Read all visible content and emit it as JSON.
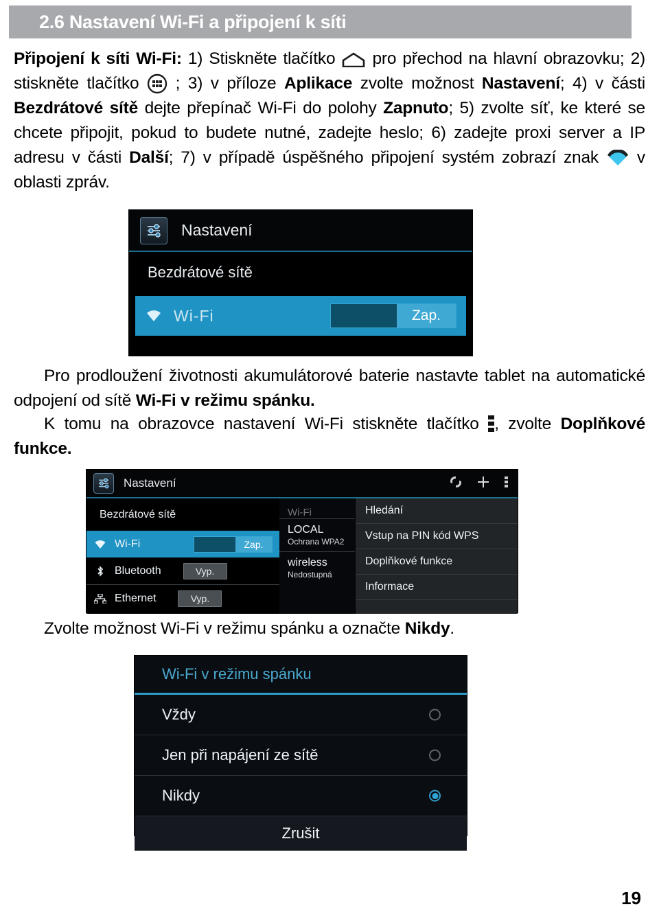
{
  "header": {
    "number": "2.6",
    "title": "2.6 Nastavení Wi-Fi a připojení k síti",
    "bg_color": "#a8a9ad",
    "text_color": "#ffffff"
  },
  "paragraphs": {
    "p1_lead": "Připojení k síti Wi-Fi:",
    "p1_a": " 1) Stiskněte tlačítko ",
    "p1_b": " pro přechod na hlavní obrazovku; 2) stiskněte tlačítko ",
    "p1_c": " ; 3) v příloze ",
    "p1_bold1": "Aplikace",
    "p1_d": " zvolte možnost ",
    "p1_bold2": "Nastavení",
    "p1_e": "; 4) v části ",
    "p1_bold3": "Bezdrátové sítě",
    "p1_f": " dejte přepínač Wi-Fi do polohy ",
    "p1_bold4": "Zapnuto",
    "p1_g": "; 5) zvolte síť, ke které se chcete připojit, pokud to budete nutné, zadejte heslo; 6) zadejte proxi server a IP adresu v části ",
    "p1_bold5": "Další",
    "p1_h": "; 7) v případě úspěšného připojení systém zobrazí znak ",
    "p1_i": " v oblasti zpráv.",
    "p2_a": "Pro prodloužení životnosti akumulátorové baterie nastavte tablet na automatické odpojení od sítě ",
    "p2_bold": "Wi-Fi v režimu spánku.",
    "p3_a": "K tomu na obrazovce nastavení Wi-Fi stiskněte tlačítko ",
    "p3_b": ", zvolte ",
    "p3_bold": "Doplňkové",
    "p3_c": " funkce.",
    "p4_a": "Zvolte možnost Wi-Fi  v režimu spánku a označte ",
    "p4_bold": "Nikdy",
    "p4_b": "."
  },
  "shot1": {
    "appbar_title": "Nastavení",
    "section_label": "Bezdrátové sítě",
    "wifi_label": "Wi-Fi",
    "wifi_toggle": "Zap.",
    "highlight_color": "#1f94c4"
  },
  "shot2": {
    "appbar_title": "Nastavení",
    "section_label": "Bezdrátové sítě",
    "rows": [
      {
        "label": "Wi-Fi",
        "toggle": "Zap.",
        "state": "on",
        "icon": "wifi-icon"
      },
      {
        "label": "Bluetooth",
        "toggle": "Vyp.",
        "state": "off",
        "icon": "bluetooth-icon"
      },
      {
        "label": "Ethernet",
        "toggle": "Vyp.",
        "state": "off",
        "icon": "ethernet-icon"
      }
    ],
    "networks_header": "Wi-Fi",
    "networks": [
      {
        "name": "LOCAL",
        "status": "Ochrana WPA2"
      },
      {
        "name": "wireless",
        "status": "Nedostupná"
      }
    ],
    "menu_items": [
      "Hledání",
      "Vstup na PIN kód WPS",
      "Doplňkové funkce",
      "Informace"
    ]
  },
  "shot3": {
    "title": "Wi-Fi v režimu spánku",
    "options": [
      {
        "label": "Vždy",
        "selected": false
      },
      {
        "label": "Jen při napájení ze sítě",
        "selected": false
      },
      {
        "label": "Nikdy",
        "selected": true
      }
    ],
    "cancel_label": "Zrušit",
    "accent_color": "#2e9ec8"
  },
  "footer": {
    "page_number": "19"
  }
}
